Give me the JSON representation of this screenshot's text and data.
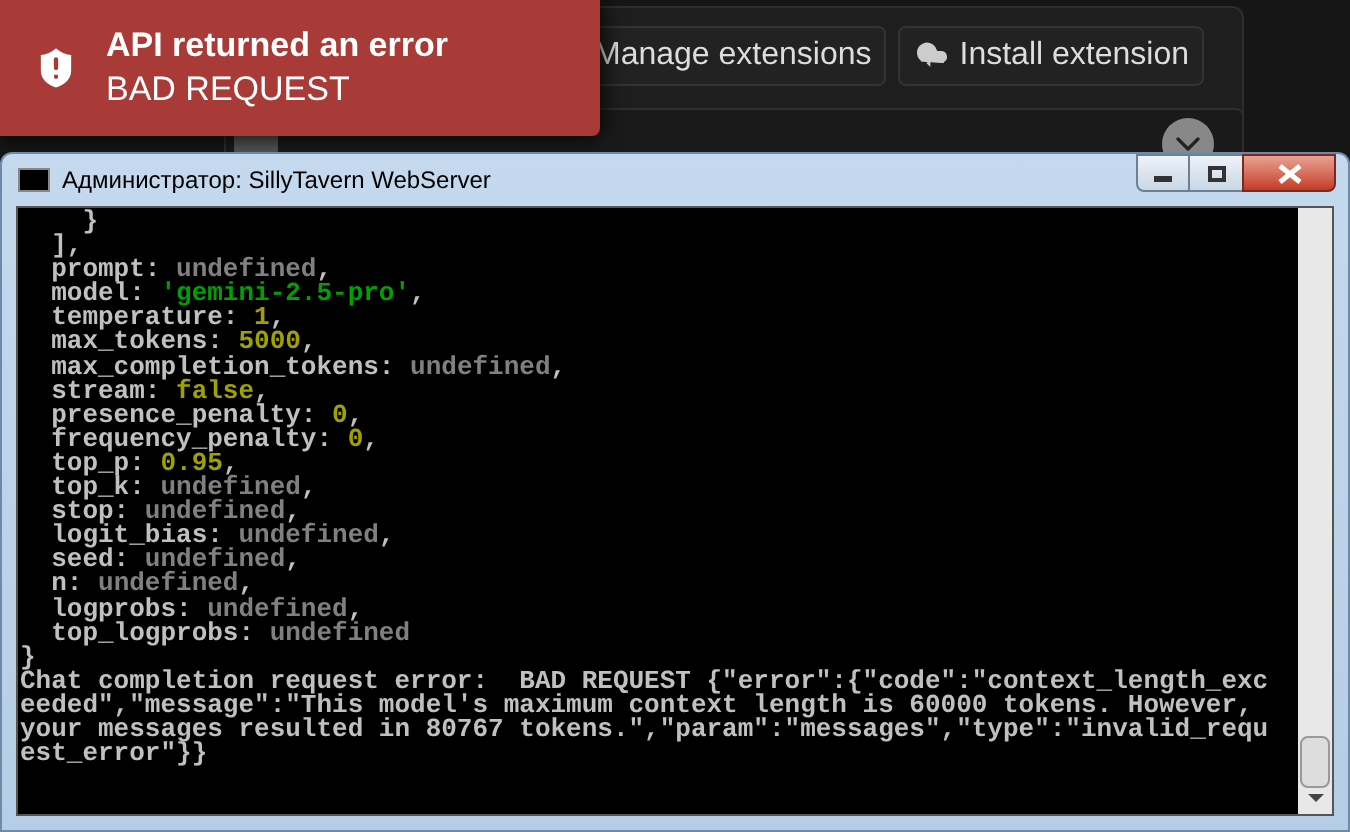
{
  "toast": {
    "title": "API returned an error",
    "message": "BAD REQUEST"
  },
  "extensions": {
    "buttons": [
      {
        "label": "Manage extensions"
      },
      {
        "label": "Install extension"
      }
    ]
  },
  "console": {
    "title": "Администратор: SillyTavern WebServer",
    "lines": [
      [
        {
          "t": "    }",
          "kind": "plain"
        }
      ],
      [
        {
          "t": "  ],",
          "kind": "plain"
        }
      ],
      [
        {
          "t": "  prompt: ",
          "kind": "plain"
        },
        {
          "t": "undefined",
          "kind": "undefined"
        },
        {
          "t": ",",
          "kind": "plain"
        }
      ],
      [
        {
          "t": "  model: ",
          "kind": "plain"
        },
        {
          "t": "'gemini-2.5-pro'",
          "kind": "string"
        },
        {
          "t": ",",
          "kind": "plain"
        }
      ],
      [
        {
          "t": "  temperature: ",
          "kind": "plain"
        },
        {
          "t": "1",
          "kind": "number"
        },
        {
          "t": ",",
          "kind": "plain"
        }
      ],
      [
        {
          "t": "  max_tokens: ",
          "kind": "plain"
        },
        {
          "t": "5000",
          "kind": "number"
        },
        {
          "t": ",",
          "kind": "plain"
        }
      ],
      [
        {
          "t": "  max_completion_tokens: ",
          "kind": "plain"
        },
        {
          "t": "undefined",
          "kind": "undefined"
        },
        {
          "t": ",",
          "kind": "plain"
        }
      ],
      [
        {
          "t": "  stream: ",
          "kind": "plain"
        },
        {
          "t": "false",
          "kind": "number"
        },
        {
          "t": ",",
          "kind": "plain"
        }
      ],
      [
        {
          "t": "  presence_penalty: ",
          "kind": "plain"
        },
        {
          "t": "0",
          "kind": "number"
        },
        {
          "t": ",",
          "kind": "plain"
        }
      ],
      [
        {
          "t": "  frequency_penalty: ",
          "kind": "plain"
        },
        {
          "t": "0",
          "kind": "number"
        },
        {
          "t": ",",
          "kind": "plain"
        }
      ],
      [
        {
          "t": "  top_p: ",
          "kind": "plain"
        },
        {
          "t": "0.95",
          "kind": "number"
        },
        {
          "t": ",",
          "kind": "plain"
        }
      ],
      [
        {
          "t": "  top_k: ",
          "kind": "plain"
        },
        {
          "t": "undefined",
          "kind": "undefined"
        },
        {
          "t": ",",
          "kind": "plain"
        }
      ],
      [
        {
          "t": "  stop: ",
          "kind": "plain"
        },
        {
          "t": "undefined",
          "kind": "undefined"
        },
        {
          "t": ",",
          "kind": "plain"
        }
      ],
      [
        {
          "t": "  logit_bias: ",
          "kind": "plain"
        },
        {
          "t": "undefined",
          "kind": "undefined"
        },
        {
          "t": ",",
          "kind": "plain"
        }
      ],
      [
        {
          "t": "  seed: ",
          "kind": "plain"
        },
        {
          "t": "undefined",
          "kind": "undefined"
        },
        {
          "t": ",",
          "kind": "plain"
        }
      ],
      [
        {
          "t": "  n: ",
          "kind": "plain"
        },
        {
          "t": "undefined",
          "kind": "undefined"
        },
        {
          "t": ",",
          "kind": "plain"
        }
      ],
      [
        {
          "t": "  logprobs: ",
          "kind": "plain"
        },
        {
          "t": "undefined",
          "kind": "undefined"
        },
        {
          "t": ",",
          "kind": "plain"
        }
      ],
      [
        {
          "t": "  top_logprobs: ",
          "kind": "plain"
        },
        {
          "t": "undefined",
          "kind": "undefined"
        }
      ],
      [
        {
          "t": "}",
          "kind": "plain"
        }
      ],
      [
        {
          "t": "Chat completion request error:  BAD REQUEST {\"error\":{\"code\":\"context_length_exc",
          "kind": "plain"
        }
      ],
      [
        {
          "t": "eeded\",\"message\":\"This model's maximum context length is 60000 tokens. However,",
          "kind": "plain"
        }
      ],
      [
        {
          "t": "your messages resulted in 80767 tokens.\",\"param\":\"messages\",\"type\":\"invalid_requ",
          "kind": "plain"
        }
      ],
      [
        {
          "t": "est_error\"}}",
          "kind": "plain"
        }
      ]
    ]
  }
}
